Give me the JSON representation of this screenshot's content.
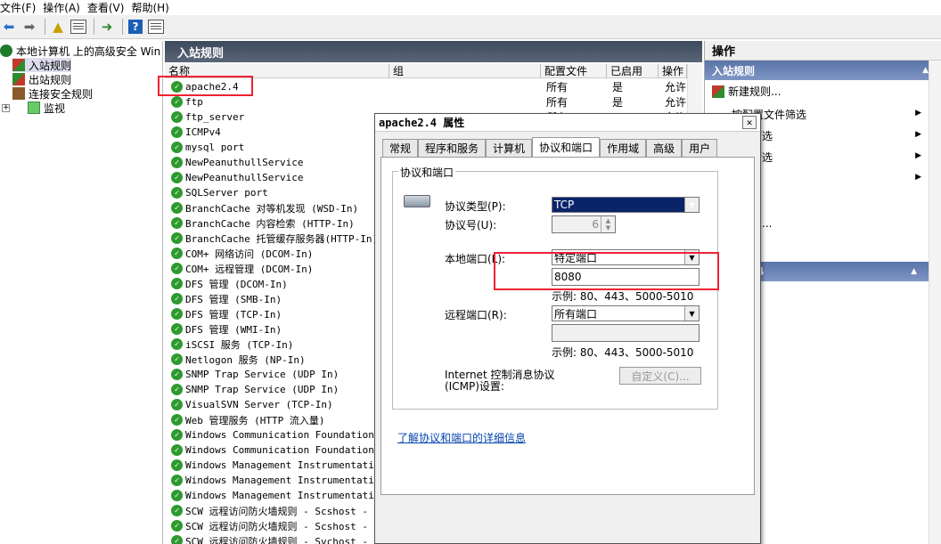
{
  "menubar": [
    "文件(F)",
    "操作(A)",
    "查看(V)",
    "帮助(H)"
  ],
  "tree": {
    "root": "本地计算机 上的高级安全 Win",
    "items": [
      "入站规则",
      "出站规则",
      "连接安全规则",
      "监视"
    ]
  },
  "center": {
    "title": "入站规则",
    "columns": [
      "名称",
      "组",
      "配置文件",
      "已启用",
      "操作"
    ],
    "rows": [
      {
        "name": "apache2.4",
        "profile": "所有",
        "enabled": "是",
        "action": "允许"
      },
      {
        "name": "ftp",
        "profile": "所有",
        "enabled": "是",
        "action": "允许"
      },
      {
        "name": "ftp_server",
        "profile": "所有",
        "enabled": "",
        "action": "允许"
      },
      {
        "name": "ICMPv4",
        "profile": "",
        "enabled": "",
        "action": ""
      },
      {
        "name": "mysql port",
        "profile": "",
        "enabled": "",
        "action": ""
      },
      {
        "name": "NewPeanuthullService",
        "profile": "",
        "enabled": "",
        "action": ""
      },
      {
        "name": "NewPeanuthullService",
        "profile": "",
        "enabled": "",
        "action": ""
      },
      {
        "name": "SQLServer port",
        "profile": "",
        "enabled": "",
        "action": ""
      },
      {
        "name": "BranchCache 对等机发现 (WSD-In)",
        "profile": "",
        "enabled": "",
        "action": ""
      },
      {
        "name": "BranchCache 内容检索 (HTTP-In)",
        "profile": "",
        "enabled": "",
        "action": ""
      },
      {
        "name": "BranchCache 托管缓存服务器(HTTP-In)",
        "profile": "",
        "enabled": "",
        "action": ""
      },
      {
        "name": "COM+ 网络访问 (DCOM-In)",
        "profile": "",
        "enabled": "",
        "action": ""
      },
      {
        "name": "COM+ 远程管理 (DCOM-In)",
        "profile": "",
        "enabled": "",
        "action": ""
      },
      {
        "name": "DFS 管理 (DCOM-In)",
        "profile": "",
        "enabled": "",
        "action": ""
      },
      {
        "name": "DFS 管理 (SMB-In)",
        "profile": "",
        "enabled": "",
        "action": ""
      },
      {
        "name": "DFS 管理 (TCP-In)",
        "profile": "",
        "enabled": "",
        "action": ""
      },
      {
        "name": "DFS 管理 (WMI-In)",
        "profile": "",
        "enabled": "",
        "action": ""
      },
      {
        "name": "iSCSI 服务 (TCP-In)",
        "profile": "",
        "enabled": "",
        "action": ""
      },
      {
        "name": "Netlogon 服务 (NP-In)",
        "profile": "",
        "enabled": "",
        "action": ""
      },
      {
        "name": "SNMP Trap Service (UDP In)",
        "profile": "",
        "enabled": "",
        "action": ""
      },
      {
        "name": "SNMP Trap Service (UDP In)",
        "profile": "",
        "enabled": "",
        "action": ""
      },
      {
        "name": "VisualSVN Server (TCP-In)",
        "profile": "",
        "enabled": "",
        "action": ""
      },
      {
        "name": "Web 管理服务 (HTTP 流入量)",
        "profile": "",
        "enabled": "",
        "action": ""
      },
      {
        "name": "Windows Communication Foundation N.",
        "profile": "",
        "enabled": "",
        "action": ""
      },
      {
        "name": "Windows Communication Foundation N.",
        "profile": "",
        "enabled": "",
        "action": ""
      },
      {
        "name": "Windows Management Instrumentation.",
        "profile": "",
        "enabled": "",
        "action": ""
      },
      {
        "name": "Windows Management Instrumentation.",
        "profile": "",
        "enabled": "",
        "action": ""
      },
      {
        "name": "Windows Management Instrumentation.",
        "profile": "",
        "enabled": "",
        "action": ""
      },
      {
        "name": "SCW 远程访问防火墙规则 - Scshost -",
        "profile": "",
        "enabled": "",
        "action": ""
      },
      {
        "name": "SCW 远程访问防火墙规则 - Scshost -",
        "profile": "",
        "enabled": "",
        "action": ""
      },
      {
        "name": "SCW 远程访问防火墙规则 - Svchost -",
        "profile": "",
        "enabled": "",
        "action": ""
      }
    ]
  },
  "actions": {
    "title": "操作",
    "section1": "入站规则",
    "items": [
      "新建规则...",
      "按配置文件筛选",
      "筛选",
      "筛选",
      "",
      "表..."
    ],
    "section2": "4",
    "items2": [
      "则"
    ]
  },
  "dialog": {
    "title": "apache2.4 属性",
    "tabs": [
      "常规",
      "程序和服务",
      "计算机",
      "协议和端口",
      "作用域",
      "高级",
      "用户"
    ],
    "group_title": "协议和端口",
    "protocol_type_label": "协议类型(P):",
    "protocol_type_value": "TCP",
    "protocol_number_label": "协议号(U):",
    "protocol_number_value": "6",
    "local_port_label": "本地端口(L):",
    "local_port_mode": "特定端口",
    "local_port_value": "8080",
    "local_port_example": "示例: 80、443、5000-5010",
    "remote_port_label": "远程端口(R):",
    "remote_port_mode": "所有端口",
    "remote_port_value": "",
    "remote_port_example": "示例: 80、443、5000-5010",
    "icmp_label": "Internet 控制消息协议(ICMP)设置:",
    "custom_button": "自定义(C)...",
    "learn_more_link": "了解协议和端口的详细信息",
    "close_glyph": "✕"
  },
  "colors": {
    "highlight_box": "#e23333",
    "selection": "#0a246a"
  }
}
